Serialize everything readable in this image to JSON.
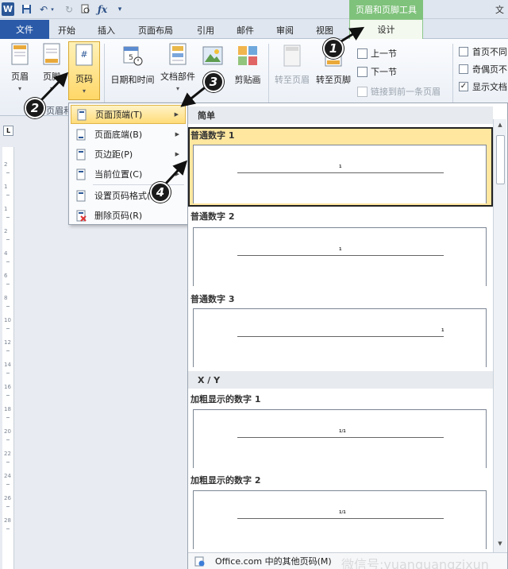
{
  "app": {
    "logo": "W",
    "context_tool_title": "页眉和页脚工具",
    "corner_text": "文"
  },
  "tabs": [
    {
      "label": "文件"
    },
    {
      "label": "开始"
    },
    {
      "label": "插入"
    },
    {
      "label": "页面布局"
    },
    {
      "label": "引用"
    },
    {
      "label": "邮件"
    },
    {
      "label": "审阅"
    },
    {
      "label": "视图"
    },
    {
      "label": "设计"
    }
  ],
  "ribbon": {
    "header": "页眉",
    "footer": "页脚",
    "page_number": "页码",
    "date_time": "日期和时间",
    "doc_parts": "文档部件",
    "picture": "图片",
    "clip_art": "剪贴画",
    "goto_header": "转至页眉",
    "goto_footer": "转至页脚",
    "prev_section": "上一节",
    "next_section": "下一节",
    "link_previous": "链接到前一条页眉",
    "group_label": "页眉和页",
    "options": [
      {
        "label": "首页不同",
        "checked": false
      },
      {
        "label": "奇偶页不",
        "checked": false
      },
      {
        "label": "显示文档",
        "checked": true
      }
    ]
  },
  "ruler": {
    "corner": "L",
    "numbers": [
      "2",
      "1",
      "1",
      "2",
      "4",
      "6",
      "8",
      "10",
      "12",
      "14",
      "16",
      "18",
      "20",
      "22",
      "24",
      "26",
      "28"
    ]
  },
  "menu": {
    "items": [
      {
        "label": "页面顶端(T)",
        "has_sub": true,
        "highlighted": true
      },
      {
        "label": "页面底端(B)",
        "has_sub": true
      },
      {
        "label": "页边距(P)",
        "has_sub": true
      },
      {
        "label": "当前位置(C)",
        "has_sub": true
      },
      {
        "label": "设置页码格式(F)..."
      },
      {
        "label": "删除页码(R)"
      }
    ]
  },
  "gallery": {
    "sections": [
      {
        "header": "简单",
        "items": [
          {
            "label": "普通数字 1",
            "sample": "1",
            "align": "center",
            "selected": true
          },
          {
            "label": "普通数字 2",
            "sample": "1",
            "align": "center"
          },
          {
            "label": "普通数字 3",
            "sample": "1",
            "align": "right"
          }
        ]
      },
      {
        "header": "X / Y",
        "items": [
          {
            "label": "加粗显示的数字 1",
            "sample": "1/1",
            "align": "center"
          },
          {
            "label": "加粗显示的数字 2",
            "sample": "1/1",
            "align": "center"
          }
        ]
      }
    ],
    "footer": "Office.com 中的其他页码(M)"
  },
  "annotations": [
    "1",
    "2",
    "3",
    "4"
  ],
  "watermark": "微信号:yuanguangzixun"
}
